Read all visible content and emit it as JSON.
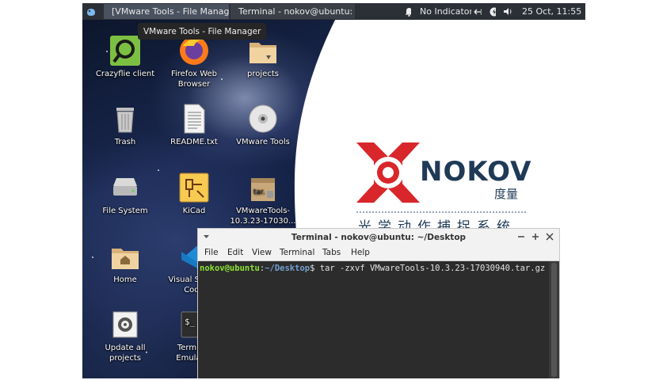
{
  "panel": {
    "menu_icon": "xfce-mouse-icon",
    "task1": "[VMware Tools - File Manag...",
    "task2": "Terminal - nokov@ubuntu: ~...",
    "notifications_icon": "bell-icon",
    "indicators": "No Indicators",
    "network_icon": "network-arrows-icon",
    "power_icon": "power-icon",
    "volume_icon": "speaker-icon",
    "clock": "25 Oct, 11:55"
  },
  "tooltip": "VMware Tools - File Manager",
  "desktop_icons": [
    {
      "label": "Crazyflie client",
      "icon": "crazyflie-icon"
    },
    {
      "label": "Firefox Web Browser",
      "icon": "firefox-icon"
    },
    {
      "label": "projects",
      "icon": "folder-icon"
    },
    {
      "label": "Trash",
      "icon": "trash-icon"
    },
    {
      "label": "README.txt",
      "icon": "text-file-icon"
    },
    {
      "label": "VMware Tools",
      "icon": "cd-icon"
    },
    {
      "label": "File System",
      "icon": "drive-icon"
    },
    {
      "label": "KiCad",
      "icon": "kicad-icon"
    },
    {
      "label": "VMwareTools-10.3.23-17030...",
      "icon": "archive-icon"
    },
    {
      "label": "Home",
      "icon": "home-folder-icon"
    },
    {
      "label": "Visual Studio Code",
      "icon": "vscode-icon"
    },
    {
      "label": "Update all projects",
      "icon": "gear-icon"
    },
    {
      "label": "Terminal Emulator",
      "icon": "terminal-icon"
    }
  ],
  "wallpaper": {
    "brand": "NOKOV",
    "brand_cn": "度量",
    "slogan": "光学动作捕捉系统",
    "brand_color": "#d9262b",
    "text_color": "#1f3a56"
  },
  "terminal": {
    "title": "Terminal - nokov@ubuntu: ~/Desktop",
    "menu": [
      "File",
      "Edit",
      "View",
      "Terminal",
      "Tabs",
      "Help"
    ],
    "prompt_user": "nokov@ubuntu",
    "prompt_sep": ":",
    "prompt_path": "~/Desktop",
    "prompt_end": "$",
    "command": "tar -zxvf VMwareTools-10.3.23-17030940.tar.gz",
    "minimize_icon": "minimize-icon",
    "maximize_icon": "maximize-icon",
    "close_icon": "close-icon",
    "window_menu_icon": "chevron-down-icon"
  }
}
